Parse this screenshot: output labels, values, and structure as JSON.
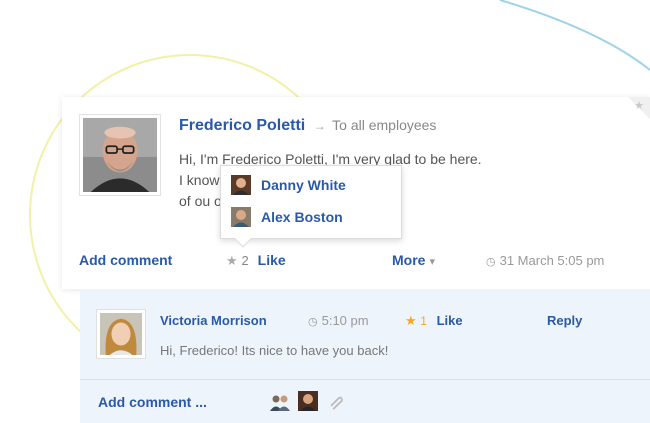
{
  "post": {
    "author": "Frederico Poletti",
    "arrow": "→",
    "audience": "To all employees",
    "lines": [
      "Hi, I'm Frederico Poletti, I'm very glad to be here.",
      "I know                                  my previous position at one",
      "of ou                                   orward to working with you."
    ],
    "corner_icon": "star-icon",
    "actions": {
      "add_comment": "Add comment",
      "like_star": "★",
      "like_count": "2",
      "like": "Like",
      "more": "More",
      "more_chevron": "▾",
      "clock": "◷",
      "timestamp": "31 March 5:05 pm"
    }
  },
  "likers_tooltip": {
    "users": [
      {
        "name": "Danny White",
        "icon": "avatar-icon"
      },
      {
        "name": "Alex Boston",
        "icon": "avatar-icon"
      }
    ]
  },
  "comment": {
    "author": "Victoria Morrison",
    "clock": "◷",
    "time": "5:10 pm",
    "star": "★",
    "like_count": "1",
    "like": "Like",
    "reply": "Reply",
    "text": "Hi, Frederico! Its nice to have you back!"
  },
  "new_comment": {
    "placeholder_link": "Add comment ...",
    "icons": [
      "users-group-icon",
      "user-icon",
      "paperclip-icon"
    ]
  },
  "colors": {
    "link_blue": "#2a5aa7",
    "star_gold": "#f5a623",
    "panel_bg": "#eef4fb",
    "deco_yellow": "#f3f0a8",
    "deco_blue": "#9fd3ea"
  }
}
